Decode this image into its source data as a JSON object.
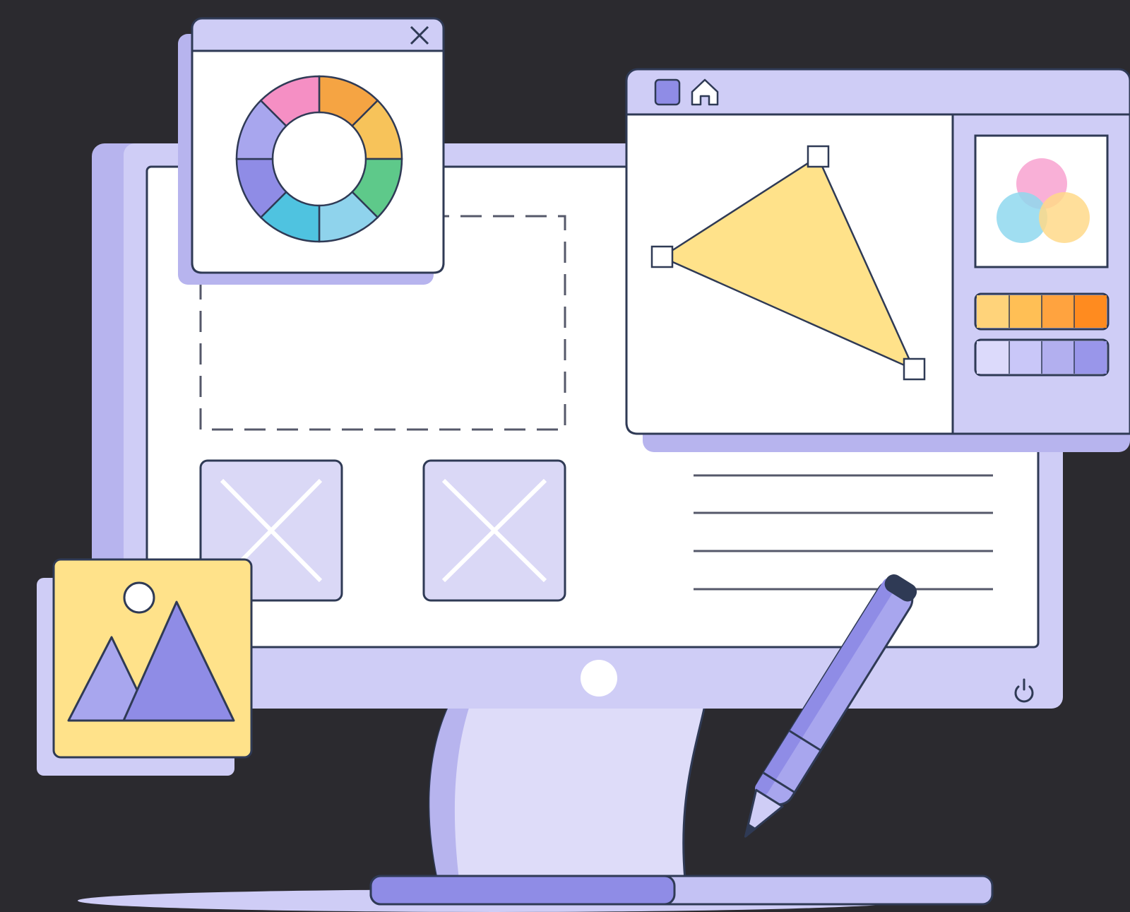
{
  "palette": {
    "background": "#2b2a2f",
    "lavender": "#cfcdf6",
    "lavender_light": "#dedcf9",
    "lavender_shadow": "#b7b4ee",
    "periwinkle": "#8f8ce6",
    "outline": "#2f3a55",
    "screen": "#ffffff",
    "yellow": "#ffe28a",
    "placeholder": "#dad8f6"
  },
  "color_wheel": {
    "segments": [
      "#f5a443",
      "#f7c35a",
      "#5ec98a",
      "#8fd3ec",
      "#4fc3e0",
      "#8f8ce6",
      "#a8a6ee",
      "#f58fc4"
    ]
  },
  "swatches": {
    "warm": [
      "#ffd37a",
      "#ffbf55",
      "#ffa33f",
      "#ff8b1f"
    ],
    "cool": [
      "#dcdafb",
      "#c9c7f8",
      "#b2afef",
      "#9996ea"
    ]
  },
  "venn": [
    "#f8a2d0",
    "#8fd8ee",
    "#ffd98a"
  ],
  "icons": {
    "close": "close-icon",
    "square": "square-icon",
    "home": "home-icon",
    "power": "power-icon",
    "image": "image-icon",
    "pen": "stylus-pen-icon"
  }
}
